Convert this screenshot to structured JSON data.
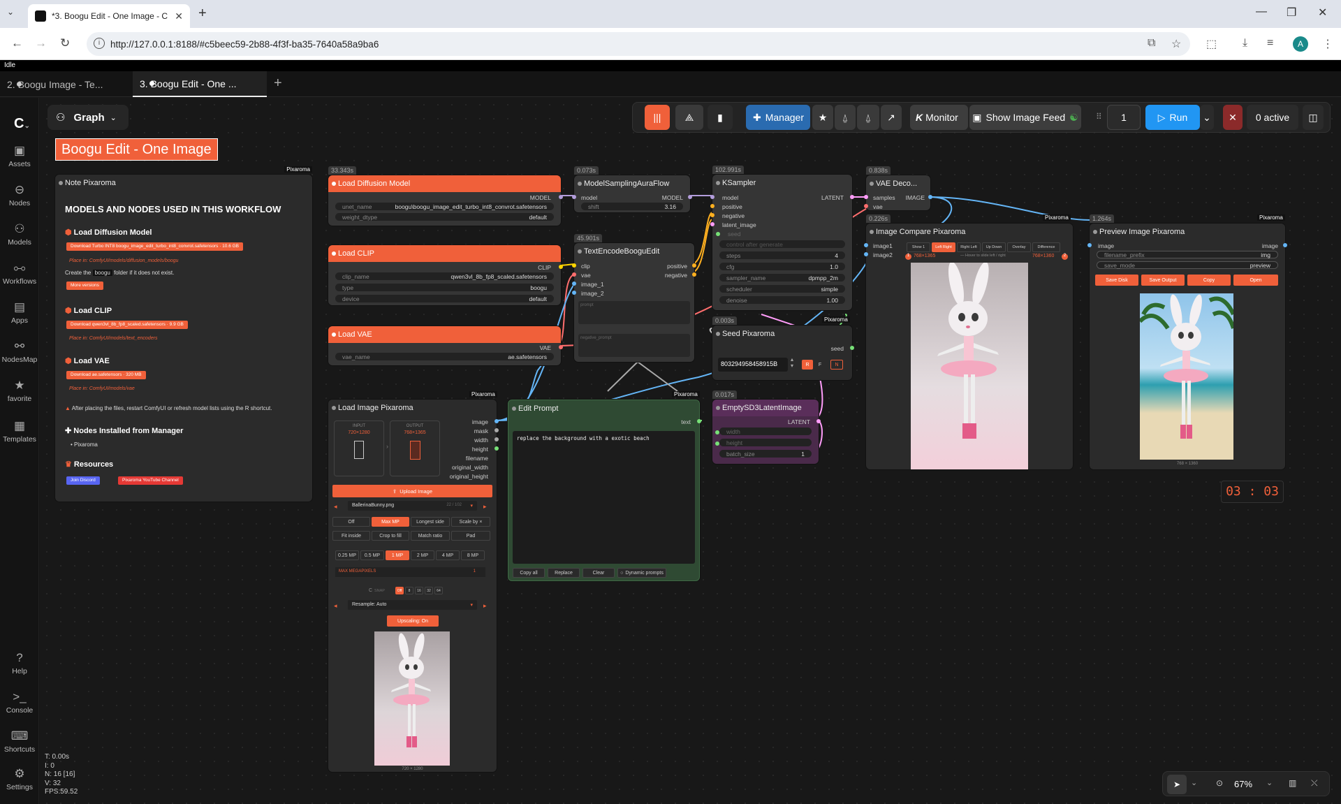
{
  "browser": {
    "tab_title": "*3. Boogu Edit - One Image - C",
    "url": "http://127.0.0.1:8188/#c5beec59-2b88-4f3f-ba35-7640a58a9ba6",
    "avatar": "A"
  },
  "status": "Idle",
  "workflow_tabs": [
    {
      "label": "2. Boogu Image - Te..."
    },
    {
      "label": "3. Boogu Edit - One ..."
    }
  ],
  "rail": [
    {
      "label": "Assets"
    },
    {
      "label": "Nodes"
    },
    {
      "label": "Models"
    },
    {
      "label": "Workflows"
    },
    {
      "label": "Apps"
    },
    {
      "label": "NodesMap"
    },
    {
      "label": "favorite"
    },
    {
      "label": "Templates"
    },
    {
      "label": "Help"
    },
    {
      "label": "Console"
    },
    {
      "label": "Shortcuts"
    },
    {
      "label": "Settings"
    }
  ],
  "graph_label": "Graph",
  "toolbar": {
    "manager": "Manager",
    "monitor": "Monitor",
    "monitor_k": "K",
    "feed": "Show Image Feed",
    "batch": "1",
    "run": "Run",
    "active": "0 active"
  },
  "workflow_title": "Boogu Edit - One Image",
  "note": {
    "title": "Note Pixaroma",
    "pixaroma": "Pixaroma",
    "heading": "MODELS AND NODES USED IN THIS WORKFLOW",
    "s1": "Load Diffusion Model",
    "s1_dl": "Download Turbo INT8 boogu_image_edit_turbo_int8_convrot.safetensors  ·  10.6 GB",
    "s1_place": "Place in: ComfyUI/models/diffusion_models/boogu",
    "s1_text": "Create the",
    "s1_code": "boogu",
    "s1_text2": "folder if it does not exist.",
    "s1_more": "More versions",
    "s2": "Load CLIP",
    "s2_dl": "Download qwen3vl_8b_fp8_scaled.safetensors  ·  9.9 GB",
    "s2_place": "Place in: ComfyUI/models/text_encoders",
    "s3": "Load VAE",
    "s3_dl": "Download ae.safetensors  ·  320 MB",
    "s3_place": "Place in: ComfyUI/models/vae",
    "warn": "After placing the files, restart ComfyUI or refresh model lists using the R shortcut.",
    "s4": "Nodes Installed from Manager",
    "s4_item": "Pixaroma",
    "s5": "Resources",
    "discord": "Join Discord",
    "youtube": "Pixaroma YouTube Channel"
  },
  "nodes": {
    "diff": {
      "title": "Load Diffusion Model",
      "time": "33.343s",
      "out": "MODEL",
      "w1": "unet_name",
      "v1": "boogu\\boogu_image_edit_turbo_int8_convrot.safetensors",
      "w2": "weight_dtype",
      "v2": "default"
    },
    "clip": {
      "title": "Load CLIP",
      "out": "CLIP",
      "w1": "clip_name",
      "v1": "qwen3vl_8b_fp8_scaled.safetensors",
      "w2": "type",
      "v2": "boogu",
      "w3": "device",
      "v3": "default"
    },
    "vae": {
      "title": "Load VAE",
      "out": "VAE",
      "w1": "vae_name",
      "v1": "ae.safetensors"
    },
    "msaf": {
      "title": "ModelSamplingAuraFlow",
      "time": "0.073s",
      "in": "model",
      "out": "MODEL",
      "w1": "shift",
      "v1": "3.16"
    },
    "tenc": {
      "title": "TextEncodeBooguEdit",
      "time": "45.901s",
      "ins": [
        "clip",
        "vae",
        "image_1",
        "image_2"
      ],
      "outs": [
        "positive",
        "negative"
      ],
      "ph1": "prompt",
      "ph2": "negative_prompt"
    },
    "ks": {
      "title": "KSampler",
      "time": "102.991s",
      "ins": [
        "model",
        "positive",
        "negative",
        "latent_image",
        "seed"
      ],
      "out": "LATENT",
      "cag": "control after generate",
      "w": [
        {
          "k": "steps",
          "v": "4"
        },
        {
          "k": "cfg",
          "v": "1.0"
        },
        {
          "k": "sampler_name",
          "v": "dpmpp_2m"
        },
        {
          "k": "scheduler",
          "v": "simple"
        },
        {
          "k": "denoise",
          "v": "1.00"
        }
      ]
    },
    "vaed": {
      "title": "VAE Deco...",
      "time": "0.838s",
      "ins": [
        "samples",
        "vae"
      ],
      "out": "IMAGE"
    },
    "seed": {
      "title": "Seed Pixaroma",
      "time": "0.003s",
      "out": "seed",
      "value": "803294958458915B",
      "pixaroma": "Pixaroma",
      "r": "R",
      "f": "F",
      "n": "N"
    },
    "cmp": {
      "title": "Image Compare Pixaroma",
      "time": "0.226s",
      "ins": [
        "image1",
        "image2"
      ],
      "modes": [
        "Show 1",
        "Left Right",
        "Right Left",
        "Up Down",
        "Overlay",
        "Difference"
      ],
      "res1": "768×1365",
      "hint": "— Hover to slide left / right",
      "res2": "768×1360",
      "pixaroma": "Pixaroma"
    },
    "prev": {
      "title": "Preview Image Pixaroma",
      "time": "1.264s",
      "in": "image",
      "out": "image",
      "w1": "filename_prefix",
      "v1": "img",
      "w2": "save_mode",
      "v2": "preview",
      "b": [
        "Save Disk",
        "Save Output",
        "Copy",
        "Open"
      ],
      "res": "768 × 1360",
      "pixaroma": "Pixaroma"
    },
    "lip": {
      "title": "Load Image Pixaroma",
      "pixaroma": "Pixaroma",
      "outs": [
        "image",
        "mask",
        "width",
        "height",
        "filename",
        "original_width",
        "original_height"
      ],
      "input": "INPUT",
      "input_res": "720×1280",
      "output": "OUTPUT",
      "output_res": "768×1365",
      "upload": "Upload Image",
      "file": "BallerinaBunny.png",
      "count": "22 / 102",
      "fit": [
        "Off",
        "Max MP",
        "Longest side",
        "Scale by ×",
        "Fit inside",
        "Crop to fill",
        "Match ratio",
        "Pad"
      ],
      "mp": [
        "0.25 MP",
        "0.5 MP",
        "1 MP",
        "2 MP",
        "4 MP",
        "8 MP"
      ],
      "maxmp": "MAX MEGAPIXELS",
      "maxmp_v": "1",
      "snap": [
        "Off",
        "8",
        "16",
        "32",
        "64"
      ],
      "snap_lbl": "SNAP",
      "resample": "Resample: Auto",
      "upscale": "Upscaling: On",
      "res": "720 × 1280"
    },
    "edit": {
      "title": "Edit Prompt",
      "pixaroma": "Pixaroma",
      "out": "text",
      "text": "replace the background with a exotic beach",
      "b": [
        "Copy all",
        "Replace",
        "Clear",
        "Dynamic prompts"
      ]
    },
    "esd": {
      "title": "EmptySD3LatentImage",
      "time": "0.017s",
      "out": "LATENT",
      "w1": "width",
      "w2": "height",
      "w3": "batch_size",
      "v3": "1"
    }
  },
  "timer": "03 : 03",
  "stats": {
    "t": "T: 0.00s",
    "i": "I: 0",
    "n": "N: 16 [16]",
    "v": "V: 32",
    "fps": "FPS:59.52"
  },
  "zoom": "67%",
  "colors": {
    "accent": "#f0603a",
    "run": "#2196f3",
    "manager": "#2a6bb0",
    "clip": "#ffd500",
    "model": "#b39ddb",
    "image": "#64b5f6",
    "latent": "#ff9cf9",
    "vae": "#ff6e6e"
  }
}
